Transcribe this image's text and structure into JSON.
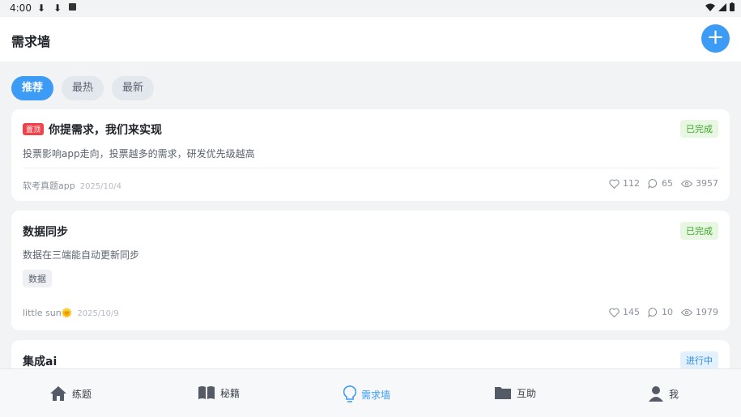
{
  "status_bar": {
    "time": "4:00"
  },
  "header": {
    "title": "需求墙",
    "add_label": "+"
  },
  "tabs": [
    {
      "label": "推荐",
      "active": true
    },
    {
      "label": "最热",
      "active": false
    },
    {
      "label": "最新",
      "active": false
    }
  ],
  "cards": [
    {
      "pin_label": "置顶",
      "title": "你提需求，我们来实现",
      "status": "已完成",
      "desc": "投票影响app走向，投票越多的需求，研发优先级越高",
      "author": "软考真题app",
      "date": "2025/10/4",
      "likes": "112",
      "comments": "65",
      "views": "3957"
    },
    {
      "title": "数据同步",
      "status": "已完成",
      "desc": "数据在三端能自动更新同步",
      "tag": "数据",
      "author": "little sun🌞",
      "date": "2025/10/9",
      "likes": "145",
      "comments": "10",
      "views": "1979"
    },
    {
      "title": "集成ai",
      "status": "进行中"
    }
  ],
  "nav": [
    {
      "label": "练题",
      "icon": "home-icon"
    },
    {
      "label": "秘籍",
      "icon": "book-icon"
    },
    {
      "label": "需求墙",
      "icon": "lightbulb-icon",
      "active": true
    },
    {
      "label": "互助",
      "icon": "folder-icon"
    },
    {
      "label": "我",
      "icon": "user-icon"
    }
  ],
  "colors": {
    "accent": "#3b9bf5",
    "done": "#3fa52b",
    "pin": "#f0424b"
  }
}
